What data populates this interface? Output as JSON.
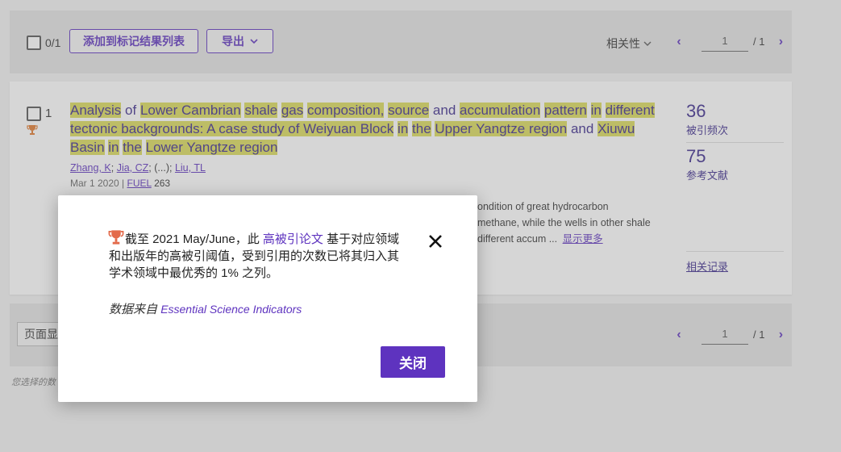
{
  "toolbar": {
    "selected_count": "0/1",
    "add_to_marked_list_label": "添加到标记结果列表",
    "export_label": "导出",
    "sort_label": "相关性",
    "page_current": "1",
    "page_total": "/ 1"
  },
  "record": {
    "index": "1",
    "title_parts": [
      "Analysis",
      "of",
      "Lower Cambrian",
      "shale",
      "gas",
      "composition,",
      "source",
      "and",
      "accumulation",
      "pattern",
      "in",
      "different",
      "tectonic backgrounds: A case study of Weiyuan Block",
      "in",
      "the",
      "Upper Yangtze region",
      "and",
      "Xiuwu Basin",
      "in",
      "the",
      "Lower Yangtze region"
    ],
    "authors": {
      "a1": "Zhang, K",
      "a2": "Jia, CZ",
      "ellipsis": "(...)",
      "a3": "Liu, TL"
    },
    "pub_date": "Mar 1 2020",
    "journal": "FUEL",
    "volume": "263",
    "abstract_line1": "ondition of great hydrocarbon",
    "abstract_line2": "methane, while the wells in other shale",
    "abstract_line3": "different accum ...",
    "show_more": "显示更多",
    "metrics": {
      "citations": "36",
      "citations_label": "被引频次",
      "references": "75",
      "references_label": "参考文献",
      "related_label": "相关记录"
    }
  },
  "bottom": {
    "page_size_label": "页面显",
    "note": "您选择的数",
    "page_current": "1",
    "page_total": "/ 1"
  },
  "modal": {
    "text_prefix": "截至 2021 May/June，此",
    "highly_cited_link": "高被引论文",
    "text_suffix": "基于对应领域和出版年的高被引阈值，受到引用的次数已将其归入其学术领域中最优秀的 1% 之列。",
    "source_prefix": "数据来自",
    "source_link": "Essential Science Indicators",
    "close_label": "关闭"
  },
  "colors": {
    "accent": "#5e33bf",
    "highlight": "#dbdb5a",
    "trophy": "#e07a2f"
  },
  "icons": [
    "trophy-icon",
    "close-icon",
    "chevron-down-icon",
    "chevron-left-icon",
    "chevron-right-icon"
  ]
}
